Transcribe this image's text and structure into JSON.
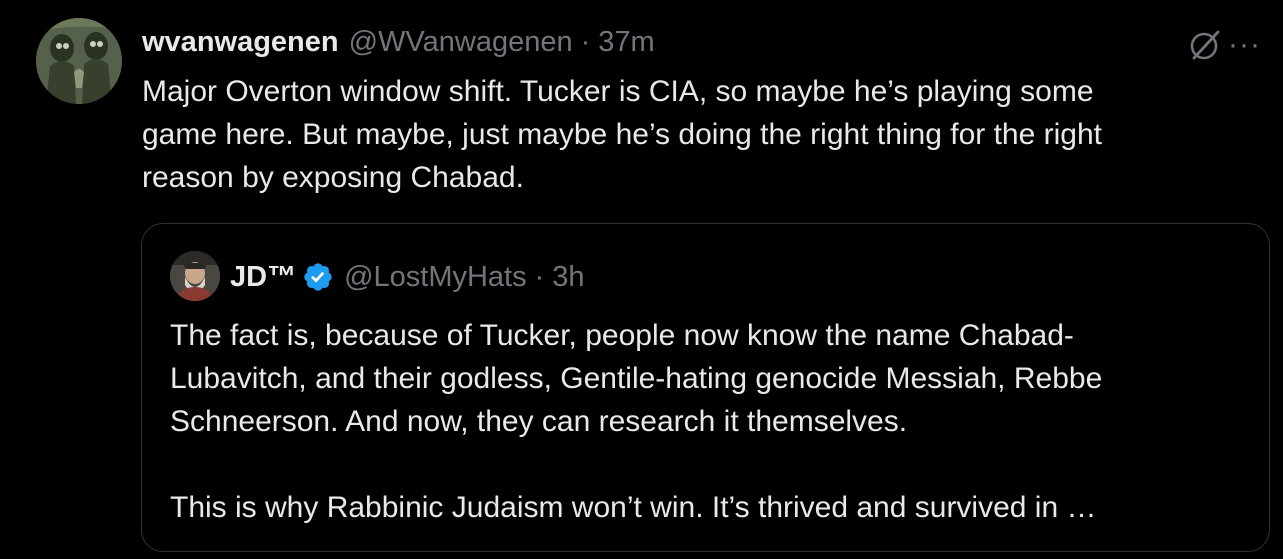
{
  "tweet": {
    "display_name": "wvanwagenen",
    "handle": "@WVanwagenen",
    "separator": "·",
    "time": "37m",
    "avatar_icon": "avatar-image",
    "text_lines": [
      "Major Overton window shift. Tucker is CIA, so maybe he’s playing some",
      "game here. But maybe, just maybe he’s doing the right thing for the right",
      "reason by exposing Chabad."
    ],
    "actions": {
      "grok_icon": "grok-icon",
      "more_label": "···"
    }
  },
  "quote": {
    "display_name": "JD™",
    "verified_icon": "verified-badge-icon",
    "handle": "@LostMyHats",
    "separator": "·",
    "time": "3h",
    "text_lines": [
      "The fact is, because of Tucker, people now know the name Chabad-",
      "Lubavitch, and their godless, Gentile-hating genocide Messiah, Rebbe",
      "Schneerson. And now, they can research it themselves."
    ],
    "text_lines_2": [
      "This is why Rabbinic Judaism won’t win. It’s thrived and survived in …"
    ]
  },
  "colors": {
    "background": "#000000",
    "text_primary": "#e7e9ea",
    "text_secondary": "#71767b",
    "border": "#2f3336",
    "verified_blue": "#1d9bf0"
  }
}
